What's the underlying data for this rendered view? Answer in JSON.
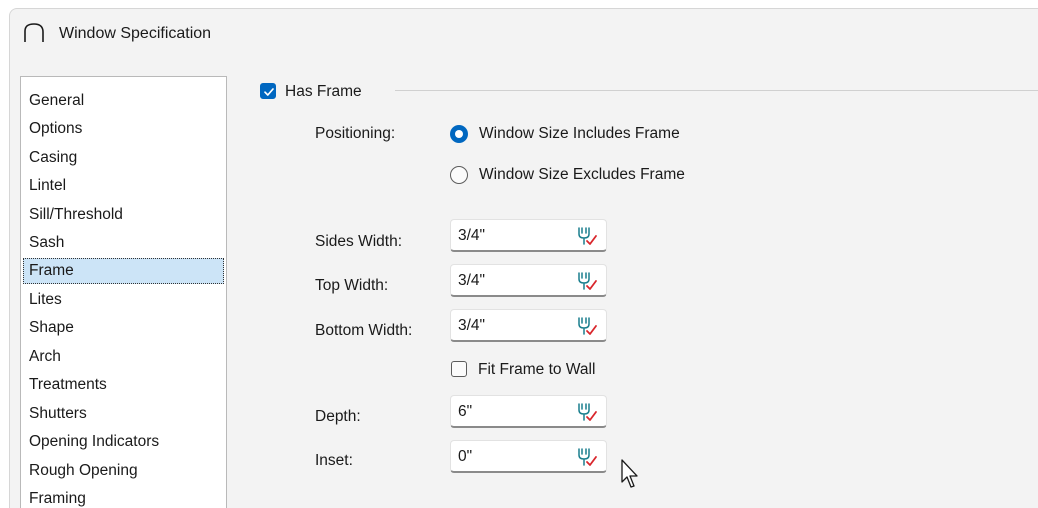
{
  "window": {
    "title": "Window Specification",
    "title_icon": "window-arch-icon"
  },
  "categories": [
    {
      "label": "General",
      "selected": false
    },
    {
      "label": "Options",
      "selected": false
    },
    {
      "label": "Casing",
      "selected": false
    },
    {
      "label": "Lintel",
      "selected": false
    },
    {
      "label": "Sill/Threshold",
      "selected": false
    },
    {
      "label": "Sash",
      "selected": false
    },
    {
      "label": "Frame",
      "selected": true
    },
    {
      "label": "Lites",
      "selected": false
    },
    {
      "label": "Shape",
      "selected": false
    },
    {
      "label": "Arch",
      "selected": false
    },
    {
      "label": "Treatments",
      "selected": false
    },
    {
      "label": "Shutters",
      "selected": false
    },
    {
      "label": "Opening Indicators",
      "selected": false
    },
    {
      "label": "Rough Opening",
      "selected": false
    },
    {
      "label": "Framing",
      "selected": false
    }
  ],
  "frame": {
    "has_frame_label": "Has Frame",
    "has_frame_checked": true,
    "positioning_label": "Positioning:",
    "positioning_options": [
      {
        "label": "Window Size Includes Frame",
        "selected": true
      },
      {
        "label": "Window Size Excludes Frame",
        "selected": false
      }
    ],
    "sides_width": {
      "label": "Sides Width:",
      "value": "3/4\""
    },
    "top_width": {
      "label": "Top Width:",
      "value": "3/4\""
    },
    "bottom_width": {
      "label": "Bottom Width:",
      "value": "3/4\""
    },
    "fit_to_wall_label": "Fit Frame to Wall",
    "fit_to_wall_checked": false,
    "depth": {
      "label": "Depth:",
      "value": "6\""
    },
    "inset": {
      "label": "Inset:",
      "value": "0\""
    },
    "field_icon": "default-value-wrench-icon"
  },
  "colors": {
    "accent": "#0067c0",
    "selection": "#cce4f7",
    "check_mark": "#d9262c",
    "icon_teal": "#1a7f8e"
  }
}
